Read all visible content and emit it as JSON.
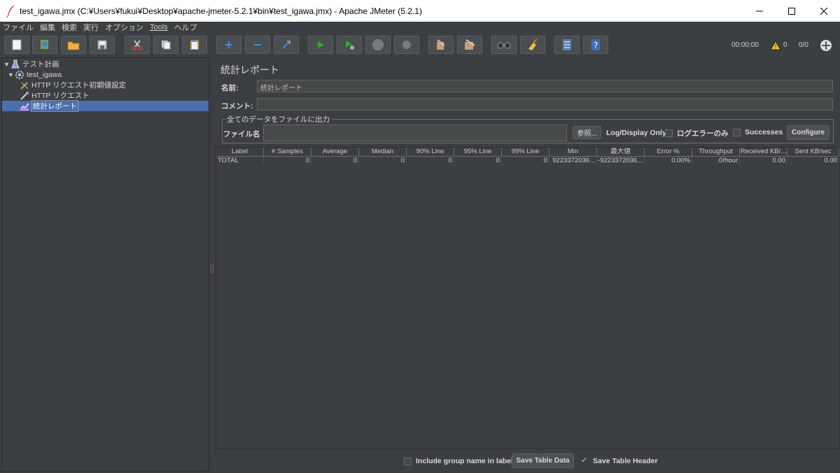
{
  "window": {
    "title": "test_igawa.jmx (C:¥Users¥fukui¥Desktop¥apache-jmeter-5.2.1¥bin¥test_igawa.jmx) - Apache JMeter (5.2.1)",
    "minimize_icon": "minimize-icon",
    "maximize_icon": "maximize-icon",
    "close_icon": "close-icon"
  },
  "menu": [
    "ファイル",
    "編集",
    "検索",
    "実行",
    "オプション",
    "Tools",
    "ヘルプ"
  ],
  "toolbar": {
    "buttons": [
      "new-icon",
      "templates-icon",
      "open-icon",
      "save-icon",
      "cut-icon",
      "copy-icon",
      "paste-icon",
      "expand-icon",
      "collapse-icon",
      "toggle-icon",
      "start-icon",
      "start-no-pause-icon",
      "stop-icon",
      "shutdown-icon",
      "clear-icon",
      "clear-all-icon",
      "search-icon",
      "reset-search-icon",
      "function-helper-icon",
      "help-icon"
    ],
    "elapsed": "00:00:00",
    "warnings": "0",
    "threads": "0/0"
  },
  "tree": {
    "items": [
      {
        "label": "テスト計画"
      },
      {
        "label": "test_igawa"
      },
      {
        "label": "HTTP リクエスト初期値設定"
      },
      {
        "label": "HTTP リクエスト"
      },
      {
        "label": "統計レポート"
      }
    ]
  },
  "panel": {
    "title": "統計レポート",
    "name_label": "名前:",
    "name_value": "統計レポート",
    "comment_label": "コメント:",
    "comment_value": "",
    "file_group_legend": "全てのデータをファイルに出力",
    "file_label": "ファイル名",
    "file_value": "",
    "browse_button": "参照...",
    "log_display_label": "Log/Display Only:",
    "errors_label": "ログエラーのみ",
    "successes_label": "Successes",
    "configure_button": "Configure"
  },
  "table": {
    "headers": [
      "Label",
      "# Samples",
      "Average",
      "Median",
      "90% Line",
      "95% Line",
      "99% Line",
      "Min",
      "最大値",
      "Error %",
      "Throughput",
      "Received KB/...",
      "Sent KB/sec"
    ],
    "rows": [
      [
        "TOTAL",
        "0",
        "0",
        "0",
        "0",
        "0",
        "0",
        "9223372036...",
        "-9223372036...",
        "0.00%",
        ".0/hour",
        "0.00",
        "0.00"
      ]
    ]
  },
  "bottom": {
    "include_group_label": "Include group name in label?",
    "save_table_data": "Save Table Data",
    "save_table_header": "Save Table Header"
  }
}
